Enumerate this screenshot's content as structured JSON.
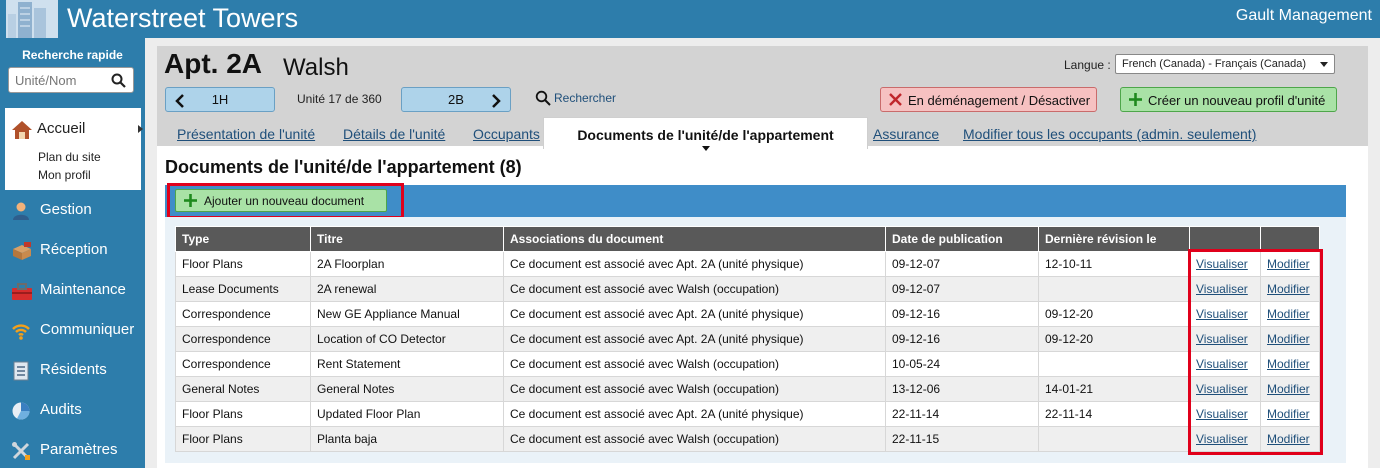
{
  "header": {
    "title": "Waterstreet Towers",
    "company": "Gault Management"
  },
  "sidebar": {
    "quick_search_title": "Recherche rapide",
    "quick_search_placeholder": "Unité/Nom",
    "home": {
      "label": "Accueil",
      "sub": [
        "Plan du site",
        "Mon profil"
      ]
    },
    "items": [
      {
        "label": "Gestion",
        "icon": "person-icon"
      },
      {
        "label": "Réception",
        "icon": "package-icon"
      },
      {
        "label": "Maintenance",
        "icon": "toolbox-icon"
      },
      {
        "label": "Communiquer",
        "icon": "wifi-icon"
      },
      {
        "label": "Résidents",
        "icon": "directory-icon"
      },
      {
        "label": "Audits",
        "icon": "pie-chart-icon"
      },
      {
        "label": "Paramètres",
        "icon": "tools-icon"
      }
    ]
  },
  "unit": {
    "title": "Apt. 2A",
    "resident": "Walsh",
    "prev_unit": "1H",
    "next_unit": "2B",
    "count": "Unité 17 de 360",
    "search_label": "Rechercher"
  },
  "language": {
    "label": "Langue :",
    "selected": "French (Canada) - Français (Canada)"
  },
  "actions": {
    "move_out": "En déménagement / Désactiver",
    "create_profile": "Créer un nouveau profil d'unité"
  },
  "tabs": [
    "Présentation de l'unité",
    "Détails de l'unité",
    "Occupants",
    "Documents de l'unité/de l'appartement",
    "Assurance",
    "Modifier tous les occupants (admin. seulement)"
  ],
  "documents": {
    "title": "Documents de l'unité/de l'appartement (8)",
    "add_button": "Ajouter un nouveau document",
    "columns": [
      "Type",
      "Titre",
      "Associations du document",
      "Date de publication",
      "Dernière révision le",
      "",
      ""
    ],
    "rows": [
      {
        "type": "Floor Plans",
        "title": "2A Floorplan",
        "assoc": "Ce document est associé avec Apt. 2A (unité physique)",
        "published": "09-12-07",
        "revised": "12-10-11",
        "view": "Visualiser",
        "edit": "Modifier"
      },
      {
        "type": "Lease Documents",
        "title": "2A renewal",
        "assoc": "Ce document est associé avec Walsh (occupation)",
        "published": "09-12-07",
        "revised": "",
        "view": "Visualiser",
        "edit": "Modifier"
      },
      {
        "type": "Correspondence",
        "title": "New GE Appliance Manual",
        "assoc": "Ce document est associé avec Apt. 2A (unité physique)",
        "published": "09-12-16",
        "revised": "09-12-20",
        "view": "Visualiser",
        "edit": "Modifier"
      },
      {
        "type": "Correspondence",
        "title": "Location of CO Detector",
        "assoc": "Ce document est associé avec Apt. 2A (unité physique)",
        "published": "09-12-16",
        "revised": "09-12-20",
        "view": "Visualiser",
        "edit": "Modifier"
      },
      {
        "type": "Correspondence",
        "title": "Rent Statement",
        "assoc": "Ce document est associé avec Walsh (occupation)",
        "published": "10-05-24",
        "revised": "",
        "view": "Visualiser",
        "edit": "Modifier"
      },
      {
        "type": "General Notes",
        "title": "General Notes",
        "assoc": "Ce document est associé avec Walsh (occupation)",
        "published": "13-12-06",
        "revised": "14-01-21",
        "view": "Visualiser",
        "edit": "Modifier"
      },
      {
        "type": "Floor Plans",
        "title": "Updated Floor Plan",
        "assoc": "Ce document est associé avec Apt. 2A (unité physique)",
        "published": "22-11-14",
        "revised": "22-11-14",
        "view": "Visualiser",
        "edit": "Modifier"
      },
      {
        "type": "Floor Plans",
        "title": "Planta baja",
        "assoc": "Ce document est associé avec Walsh (occupation)",
        "published": "22-11-15",
        "revised": "",
        "view": "Visualiser",
        "edit": "Modifier"
      }
    ]
  },
  "colors": {
    "brand_blue": "#2d7dab",
    "bar_blue": "#3f8dc8",
    "highlight_red": "#e0001b",
    "button_green": "#a9e2a6",
    "button_red": "#f6c1c1",
    "nav_button_blue": "#aed3ea"
  }
}
